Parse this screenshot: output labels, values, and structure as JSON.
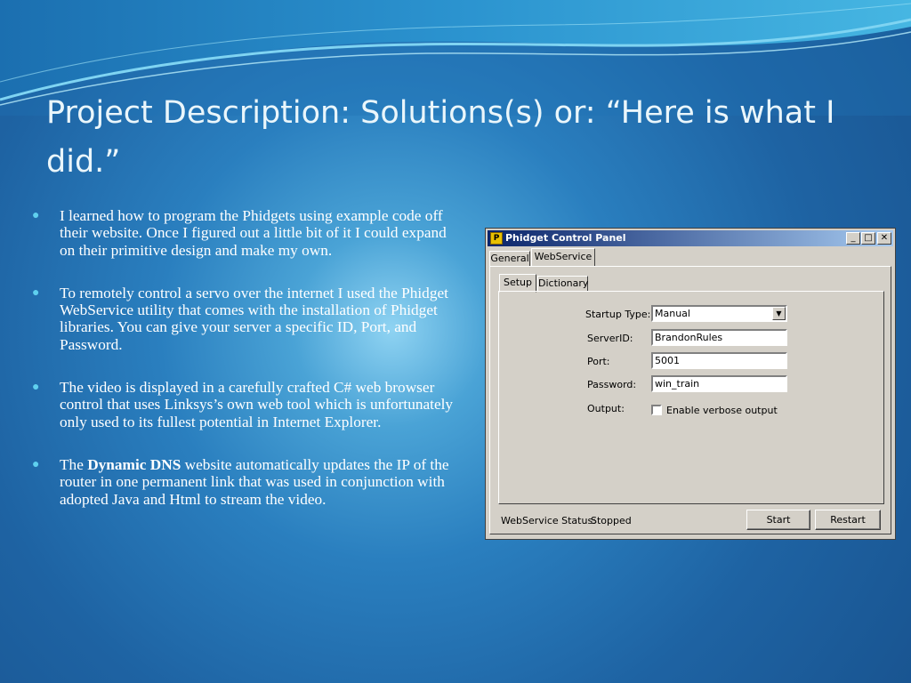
{
  "slide": {
    "title": "Project Description: Solutions(s) or: “Here is what I did.”",
    "bullets": [
      {
        "text": "I learned how to program the Phidgets using example code off their website. Once I figured out a little bit of it I could expand on their primitive design and make my own."
      },
      {
        "text": "To remotely control a servo over the internet I used the Phidget WebService utility that comes with the installation of Phidget libraries. You can give your server a specific ID, Port, and Password."
      },
      {
        "text": "The video is displayed in a carefully crafted C# web browser control that uses Linksys’s own web tool which is unfortunately only used to its fullest potential in Internet Explorer."
      },
      {
        "pre": "The ",
        "bold": "Dynamic DNS",
        "post": " website automatically updates the IP of the router in one permanent link that was used in conjunction with adopted Java and Html to stream the video."
      }
    ]
  },
  "window": {
    "title": "Phidget Control Panel",
    "controls": {
      "minimize": "_",
      "maximize": "□",
      "close": "✕"
    },
    "tabs": [
      "General",
      "WebService"
    ],
    "subtabs": [
      "Setup",
      "Dictionary"
    ],
    "form": {
      "startup_type_label": "Startup Type:",
      "startup_type_value": "Manual",
      "server_id_label": "ServerID:",
      "server_id_value": "BrandonRules",
      "port_label": "Port:",
      "port_value": "5001",
      "password_label": "Password:",
      "password_value": "win_train",
      "output_label": "Output:",
      "verbose_label": "Enable verbose output",
      "verbose_checked": false
    },
    "status_label": "WebService Status:",
    "status_value": "Stopped",
    "buttons": {
      "start": "Start",
      "restart": "Restart"
    }
  }
}
